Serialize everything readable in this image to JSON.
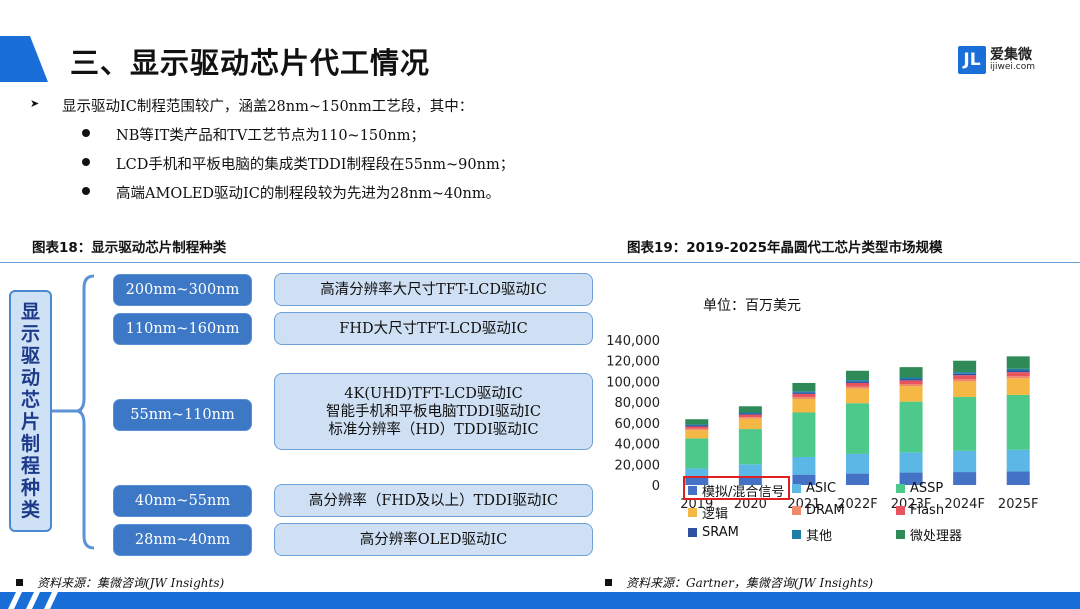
{
  "header": {
    "title": "三、显示驱动芯片代工情况",
    "logo_mark": "JL",
    "logo_name": "爱集微",
    "logo_url": "ijiwei.com"
  },
  "intro": "显示驱动IC制程范围较广，涵盖28nm~150nm工艺段，其中：",
  "bullets": [
    "NB等IT类产品和TV工艺节点为110~150nm；",
    "LCD手机和平板电脑的集成类TDDI制程段在55nm~90nm；",
    "高端AMOLED驱动IC的制程段较为先进为28nm~40nm。"
  ],
  "fig18": {
    "title": "图表18：显示驱动芯片制程种类",
    "vertical_label": [
      "显",
      "示",
      "驱",
      "动",
      "芯",
      "片",
      "制",
      "程",
      "种",
      "类"
    ],
    "nodes": [
      {
        "range": "200nm~300nm",
        "desc": [
          "高清分辨率大尺寸TFT-LCD驱动IC"
        ]
      },
      {
        "range": "110nm~160nm",
        "desc": [
          "FHD大尺寸TFT-LCD驱动IC"
        ]
      },
      {
        "range": "55nm~110nm",
        "desc": [
          "4K(UHD)TFT-LCD驱动IC",
          "智能手机和平板电脑TDDI驱动IC",
          "标准分辨率（HD）TDDI驱动IC"
        ]
      },
      {
        "range": "40nm~55nm",
        "desc": [
          "高分辨率（FHD及以上）TDDI驱动IC"
        ]
      },
      {
        "range": "28nm~40nm",
        "desc": [
          "高分辨率OLED驱动IC"
        ]
      }
    ],
    "source": "资料来源：集微咨询(JW Insights)"
  },
  "fig19": {
    "title": "图表19：2019-2025年晶圆代工芯片类型市场规模",
    "unit_label": "单位：百万美元",
    "source": "资料来源：Gartner，集微咨询(JW Insights)"
  },
  "chart_data": {
    "type": "bar",
    "stacked": true,
    "categories": [
      "2019",
      "2020",
      "2021",
      "2022F",
      "2023F",
      "2024F",
      "2025F"
    ],
    "ylim": [
      0,
      140000
    ],
    "yticks": [
      "0",
      "20,000",
      "40,000",
      "60,000",
      "80,000",
      "100,000",
      "120,000",
      "140,000"
    ],
    "series": [
      {
        "name": "模拟/混合信号",
        "color": "#4472c4",
        "values": [
          7000,
          8000,
          10000,
          11000,
          12000,
          12500,
          13000
        ]
      },
      {
        "name": "ASIC",
        "color": "#5bb7e5",
        "values": [
          9000,
          12000,
          17000,
          19000,
          19500,
          20500,
          21000
        ]
      },
      {
        "name": "ASSP",
        "color": "#4dc98b",
        "values": [
          29000,
          34000,
          43000,
          49000,
          49000,
          52000,
          53000
        ]
      },
      {
        "name": "逻辑",
        "color": "#f5b845",
        "values": [
          8000,
          10000,
          13000,
          14000,
          15000,
          15000,
          16000
        ]
      },
      {
        "name": "DRAM",
        "color": "#ef8a6b",
        "values": [
          1500,
          1500,
          2000,
          2000,
          2000,
          2000,
          2000
        ]
      },
      {
        "name": "Flash",
        "color": "#e8545e",
        "values": [
          2000,
          2500,
          3000,
          3500,
          3500,
          4000,
          4000
        ]
      },
      {
        "name": "SRAM",
        "color": "#2e4fa0",
        "values": [
          1000,
          1000,
          1200,
          1300,
          1300,
          1400,
          1500
        ]
      },
      {
        "name": "其他",
        "color": "#1e7ea8",
        "values": [
          1000,
          1000,
          1300,
          1500,
          1500,
          1600,
          1700
        ]
      },
      {
        "name": "微处理器",
        "color": "#2e8b57",
        "values": [
          5000,
          6000,
          8000,
          9000,
          10000,
          11000,
          12000
        ]
      }
    ],
    "highlight": "模拟/混合信号",
    "legend": "bottom"
  }
}
